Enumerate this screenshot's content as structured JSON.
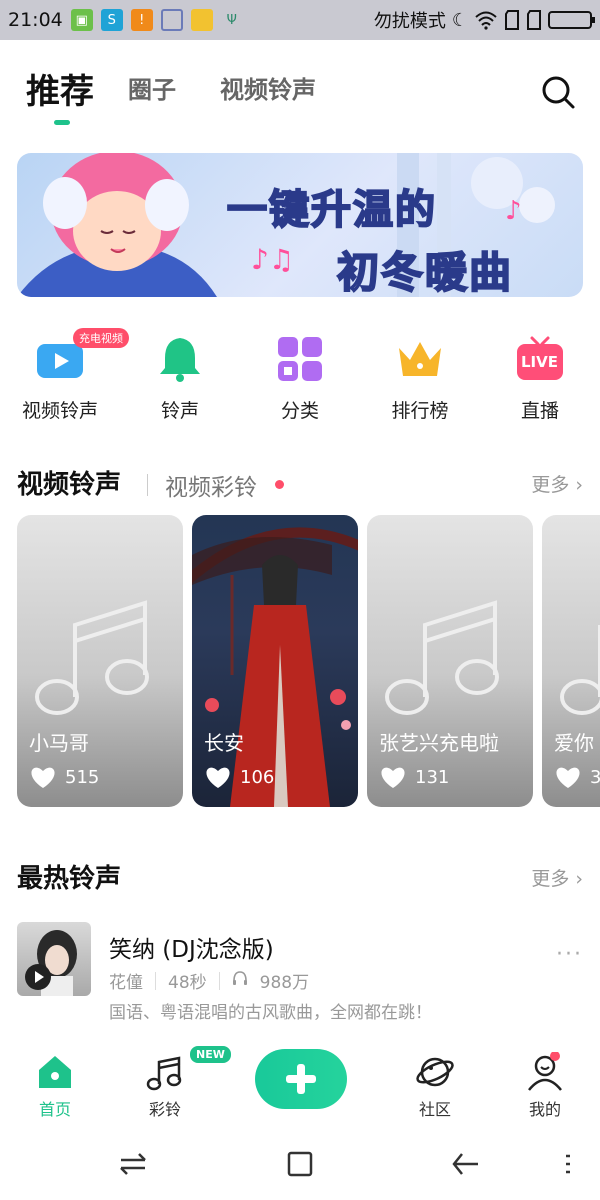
{
  "status_bar": {
    "time": "21:04",
    "dnd_label": "勿扰模式",
    "icons": [
      "app-notification-icon",
      "sync-icon",
      "warning-icon",
      "cleanup-icon",
      "folder-icon",
      "usb-icon",
      "moon-icon",
      "wifi-icon",
      "sim-icon",
      "sim-icon",
      "battery-icon"
    ]
  },
  "top_tabs": [
    {
      "label": "推荐",
      "active": true
    },
    {
      "label": "圈子",
      "active": false
    },
    {
      "label": "视频铃声",
      "active": false
    }
  ],
  "banner": {
    "line1_pre": "一键",
    "line1_highlight": "升温",
    "line1_post": "的",
    "line2": "初冬暖曲"
  },
  "categories": [
    {
      "label": "视频铃声",
      "icon": "video-icon",
      "badge": "充电视频"
    },
    {
      "label": "铃声",
      "icon": "bell-icon"
    },
    {
      "label": "分类",
      "icon": "grid-icon"
    },
    {
      "label": "排行榜",
      "icon": "crown-icon"
    },
    {
      "label": "直播",
      "icon": "live-tv-icon",
      "icon_text": "LIVE"
    }
  ],
  "video_section": {
    "title": "视频铃声",
    "sub_tab": "视频彩铃",
    "more": "更多 ›",
    "cards": [
      {
        "title": "小马哥",
        "likes": "515"
      },
      {
        "title": "长安",
        "likes": "106"
      },
      {
        "title": "张艺兴充电啦",
        "likes": "131"
      },
      {
        "title": "爱你",
        "likes": "3"
      }
    ]
  },
  "hot_section": {
    "title": "最热铃声",
    "more": "更多 ›",
    "songs": [
      {
        "name": "笑纳 (DJ沈念版)",
        "artist": "花僮",
        "duration": "48秒",
        "plays": "988万",
        "description": "国语、粤语混唱的古风歌曲，全网都在跳！"
      }
    ]
  },
  "bottom_nav": {
    "items": [
      {
        "label": "首页",
        "icon": "home-icon",
        "active": true
      },
      {
        "label": "彩铃",
        "icon": "music-note-icon",
        "badge": "NEW"
      },
      {
        "label": "",
        "icon": "plus-icon"
      },
      {
        "label": "社区",
        "icon": "planet-icon"
      },
      {
        "label": "我的",
        "icon": "profile-icon"
      }
    ]
  },
  "colors": {
    "accent": "#1ec28b",
    "badge_red": "#ff4e6a"
  }
}
